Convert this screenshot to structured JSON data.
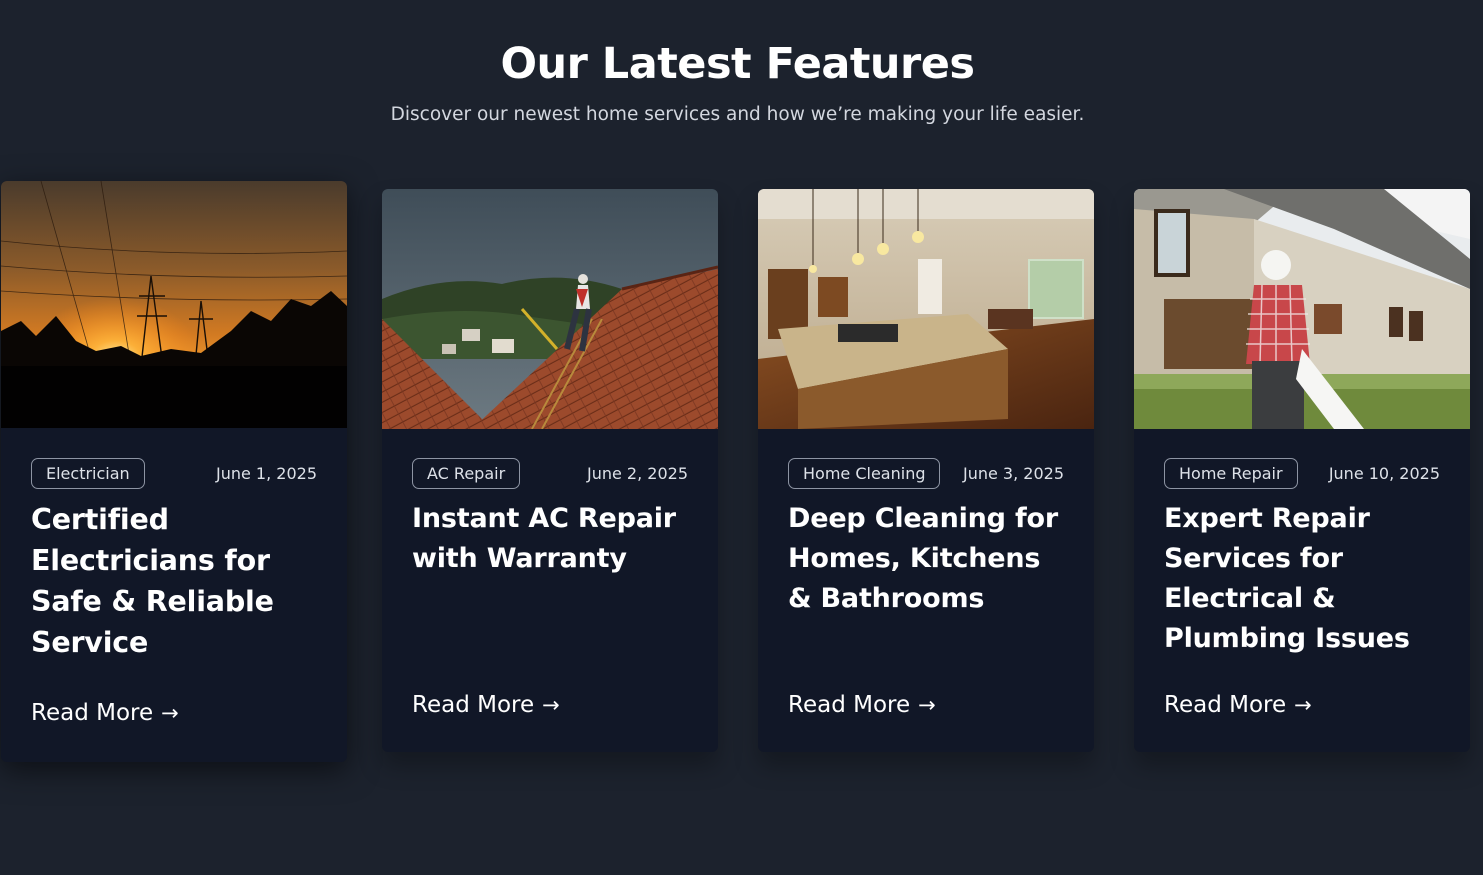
{
  "section": {
    "title": "Our Latest Features",
    "subtitle": "Discover our newest home services and how we’re making your life easier."
  },
  "cards": [
    {
      "category": "Electrician",
      "date": "June 1, 2025",
      "title": "Certified Electricians for Safe & Reliable Service",
      "link_label": "Read More",
      "arrow_icon": "arrow-right-icon",
      "image": "sunset-power-lines-photo"
    },
    {
      "category": "AC Repair",
      "date": "June 2, 2025",
      "title": "Instant AC Repair with Warranty",
      "link_label": "Read More",
      "arrow_icon": "arrow-right-icon",
      "image": "roof-repair-worker-photo"
    },
    {
      "category": "Home Cleaning",
      "date": "June 3, 2025",
      "title": "Deep Cleaning for Homes, Kitchens & Bathrooms",
      "link_label": "Read More",
      "arrow_icon": "arrow-right-icon",
      "image": "kitchen-interior-photo"
    },
    {
      "category": "Home Repair",
      "date": "June 10, 2025",
      "title": "Expert Repair Services for Electrical & Plumbing Issues",
      "link_label": "Read More",
      "arrow_icon": "arrow-right-icon",
      "image": "house-contractor-photo"
    }
  ],
  "colors": {
    "page_background": "#1c222d",
    "card_background": "#111727",
    "text": "#ffffff",
    "muted_text": "#d3d7df",
    "badge_border": "#8d94a3"
  }
}
